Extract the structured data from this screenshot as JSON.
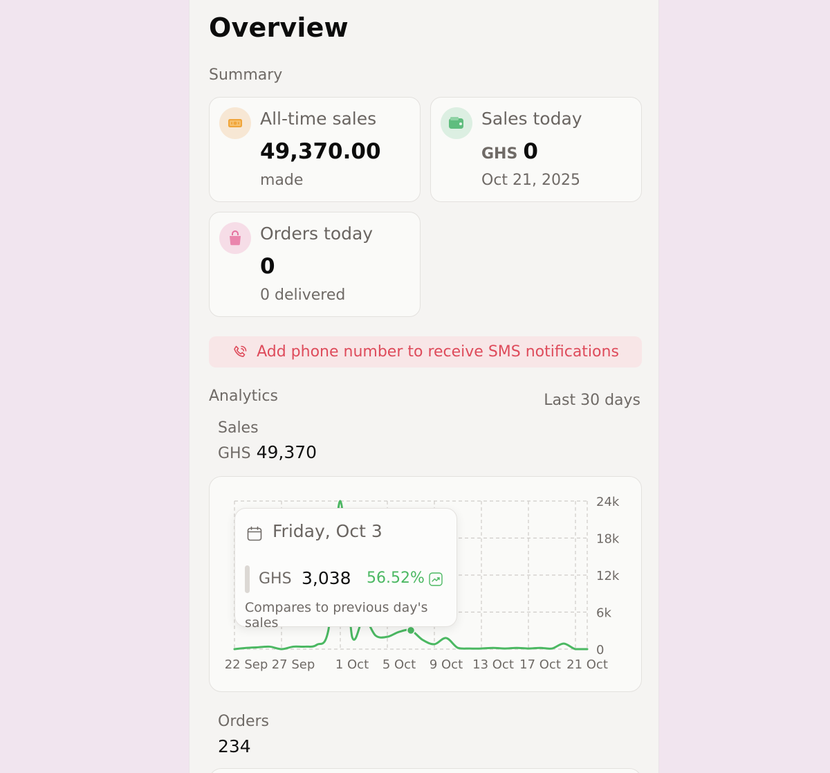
{
  "page": {
    "title": "Overview"
  },
  "summary": {
    "label": "Summary",
    "cards": {
      "all_time": {
        "title": "All-time sales",
        "value": "49,370.00",
        "sub": "made"
      },
      "today_sales": {
        "title": "Sales today",
        "currency": "GHS",
        "value": "0",
        "sub": "Oct 21, 2025"
      },
      "orders_today": {
        "title": "Orders today",
        "value": "0",
        "sub": "0 delivered"
      }
    }
  },
  "sms": {
    "text": "Add phone number to receive SMS notifications"
  },
  "analytics": {
    "label": "Analytics",
    "range": "Last 30 days",
    "sales": {
      "label": "Sales",
      "currency": "GHS",
      "value": "49,370"
    },
    "orders": {
      "label": "Orders",
      "value": "234"
    }
  },
  "tooltip": {
    "date": "Friday, Oct 3",
    "currency": "GHS",
    "value": "3,038",
    "change": "56.52%",
    "note": "Compares to previous day's sales"
  },
  "colors": {
    "line": "#4bb862",
    "sms": "#de4b5b"
  },
  "chart_data": {
    "type": "line",
    "x_labels": [
      "22 Sep",
      "27 Sep",
      "1 Oct",
      "5 Oct",
      "9 Oct",
      "13 Oct",
      "17 Oct",
      "21 Oct"
    ],
    "y_ticks": [
      "24k",
      "18k",
      "12k",
      "6k",
      "0"
    ],
    "ylim": [
      0,
      24000
    ],
    "grid": true,
    "series": [
      {
        "values": [
          0,
          200,
          300,
          400,
          0,
          400,
          400,
          700,
          3200,
          24000,
          2000,
          5000,
          2200,
          2000,
          2800,
          3038,
          1500,
          800,
          1800,
          200,
          100,
          100,
          200,
          100,
          200,
          100,
          200,
          100,
          900,
          0,
          0
        ]
      }
    ],
    "highlight_index": 15
  }
}
